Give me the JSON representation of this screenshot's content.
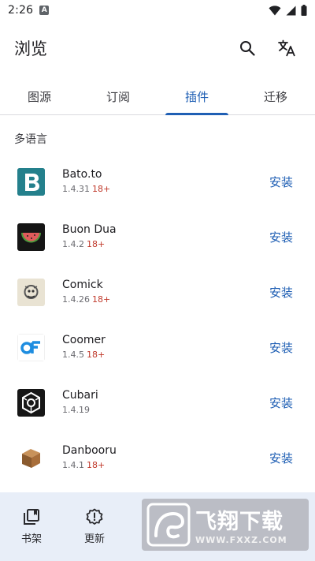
{
  "status_bar": {
    "time": "2:26",
    "indicator": "A"
  },
  "app_bar": {
    "title": "浏览",
    "actions": [
      "search-icon",
      "translate-icon"
    ]
  },
  "tabs": [
    {
      "label": "图源",
      "active": false
    },
    {
      "label": "订阅",
      "active": false
    },
    {
      "label": "插件",
      "active": true
    },
    {
      "label": "迁移",
      "active": false
    }
  ],
  "section": {
    "title": "多语言"
  },
  "extensions": [
    {
      "name": "Bato.to",
      "version": "1.4.31",
      "nsfw": "18+",
      "action": "安装"
    },
    {
      "name": "Buon Dua",
      "version": "1.4.2",
      "nsfw": "18+",
      "action": "安装"
    },
    {
      "name": "Comick",
      "version": "1.4.26",
      "nsfw": "18+",
      "action": "安装"
    },
    {
      "name": "Coomer",
      "version": "1.4.5",
      "nsfw": "18+",
      "action": "安装"
    },
    {
      "name": "Cubari",
      "version": "1.4.19",
      "nsfw": "",
      "action": "安装"
    },
    {
      "name": "Danbooru",
      "version": "1.4.1",
      "nsfw": "18+",
      "action": "安装"
    }
  ],
  "bottom_nav": [
    {
      "label": "书架",
      "icon": "library-icon"
    },
    {
      "label": "更新",
      "icon": "updates-icon"
    }
  ],
  "watermark": {
    "main": "飞翔下载",
    "sub": "WWW.FXXZ.COM"
  },
  "colors": {
    "accent": "#1f5fb4",
    "nsfw": "#c0392b",
    "bottom_nav_bg": "#e8eef8"
  }
}
